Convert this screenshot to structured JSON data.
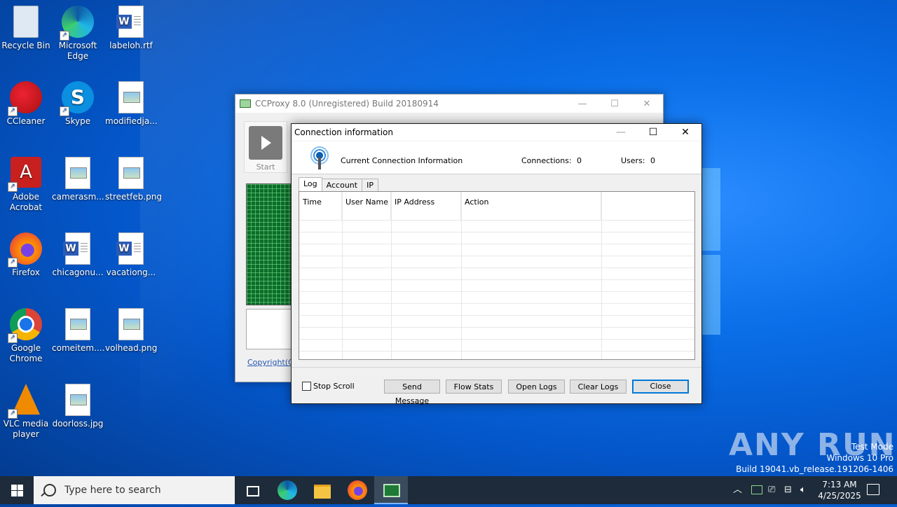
{
  "desktop": {
    "icons": [
      {
        "label": "Recycle Bin"
      },
      {
        "label": "Microsoft Edge"
      },
      {
        "label": "labeloh.rtf"
      },
      {
        "label": "CCleaner"
      },
      {
        "label": "Skype"
      },
      {
        "label": "modifiedja..."
      },
      {
        "label": "Adobe Acrobat"
      },
      {
        "label": "camerasm..."
      },
      {
        "label": "streetfeb.png"
      },
      {
        "label": "Firefox"
      },
      {
        "label": "chicagonu..."
      },
      {
        "label": "vacationg..."
      },
      {
        "label": "Google Chrome"
      },
      {
        "label": "comeitem...."
      },
      {
        "label": "volhead.png"
      },
      {
        "label": "VLC media player"
      },
      {
        "label": "doorloss.jpg"
      }
    ]
  },
  "main_window": {
    "title": "CCProxy 8.0 (Unregistered) Build 20180914",
    "start_label": "Start",
    "copyright_link": "Copyright(C)"
  },
  "dialog": {
    "title": "Connection information",
    "heading": "Current Connection Information",
    "connections_label": "Connections:",
    "connections_value": "0",
    "users_label": "Users:",
    "users_value": "0",
    "tabs": [
      "Log",
      "Account",
      "IP"
    ],
    "columns": [
      "Time",
      "User Name",
      "IP Address",
      "Action"
    ],
    "stop_scroll_label": "Stop Scroll",
    "buttons": {
      "send_message": "Send Message",
      "flow_stats": "Flow Stats",
      "open_logs": "Open Logs",
      "clear_logs": "Clear Logs",
      "close": "Close"
    }
  },
  "watermark": {
    "brand": "ANY RUN",
    "lines": [
      "Test Mode",
      "Windows 10 Pro",
      "Build 19041.vb_release.191206-1406"
    ]
  },
  "taskbar": {
    "search_placeholder": "Type here to search",
    "time": "7:13 AM",
    "date": "4/25/2025"
  }
}
